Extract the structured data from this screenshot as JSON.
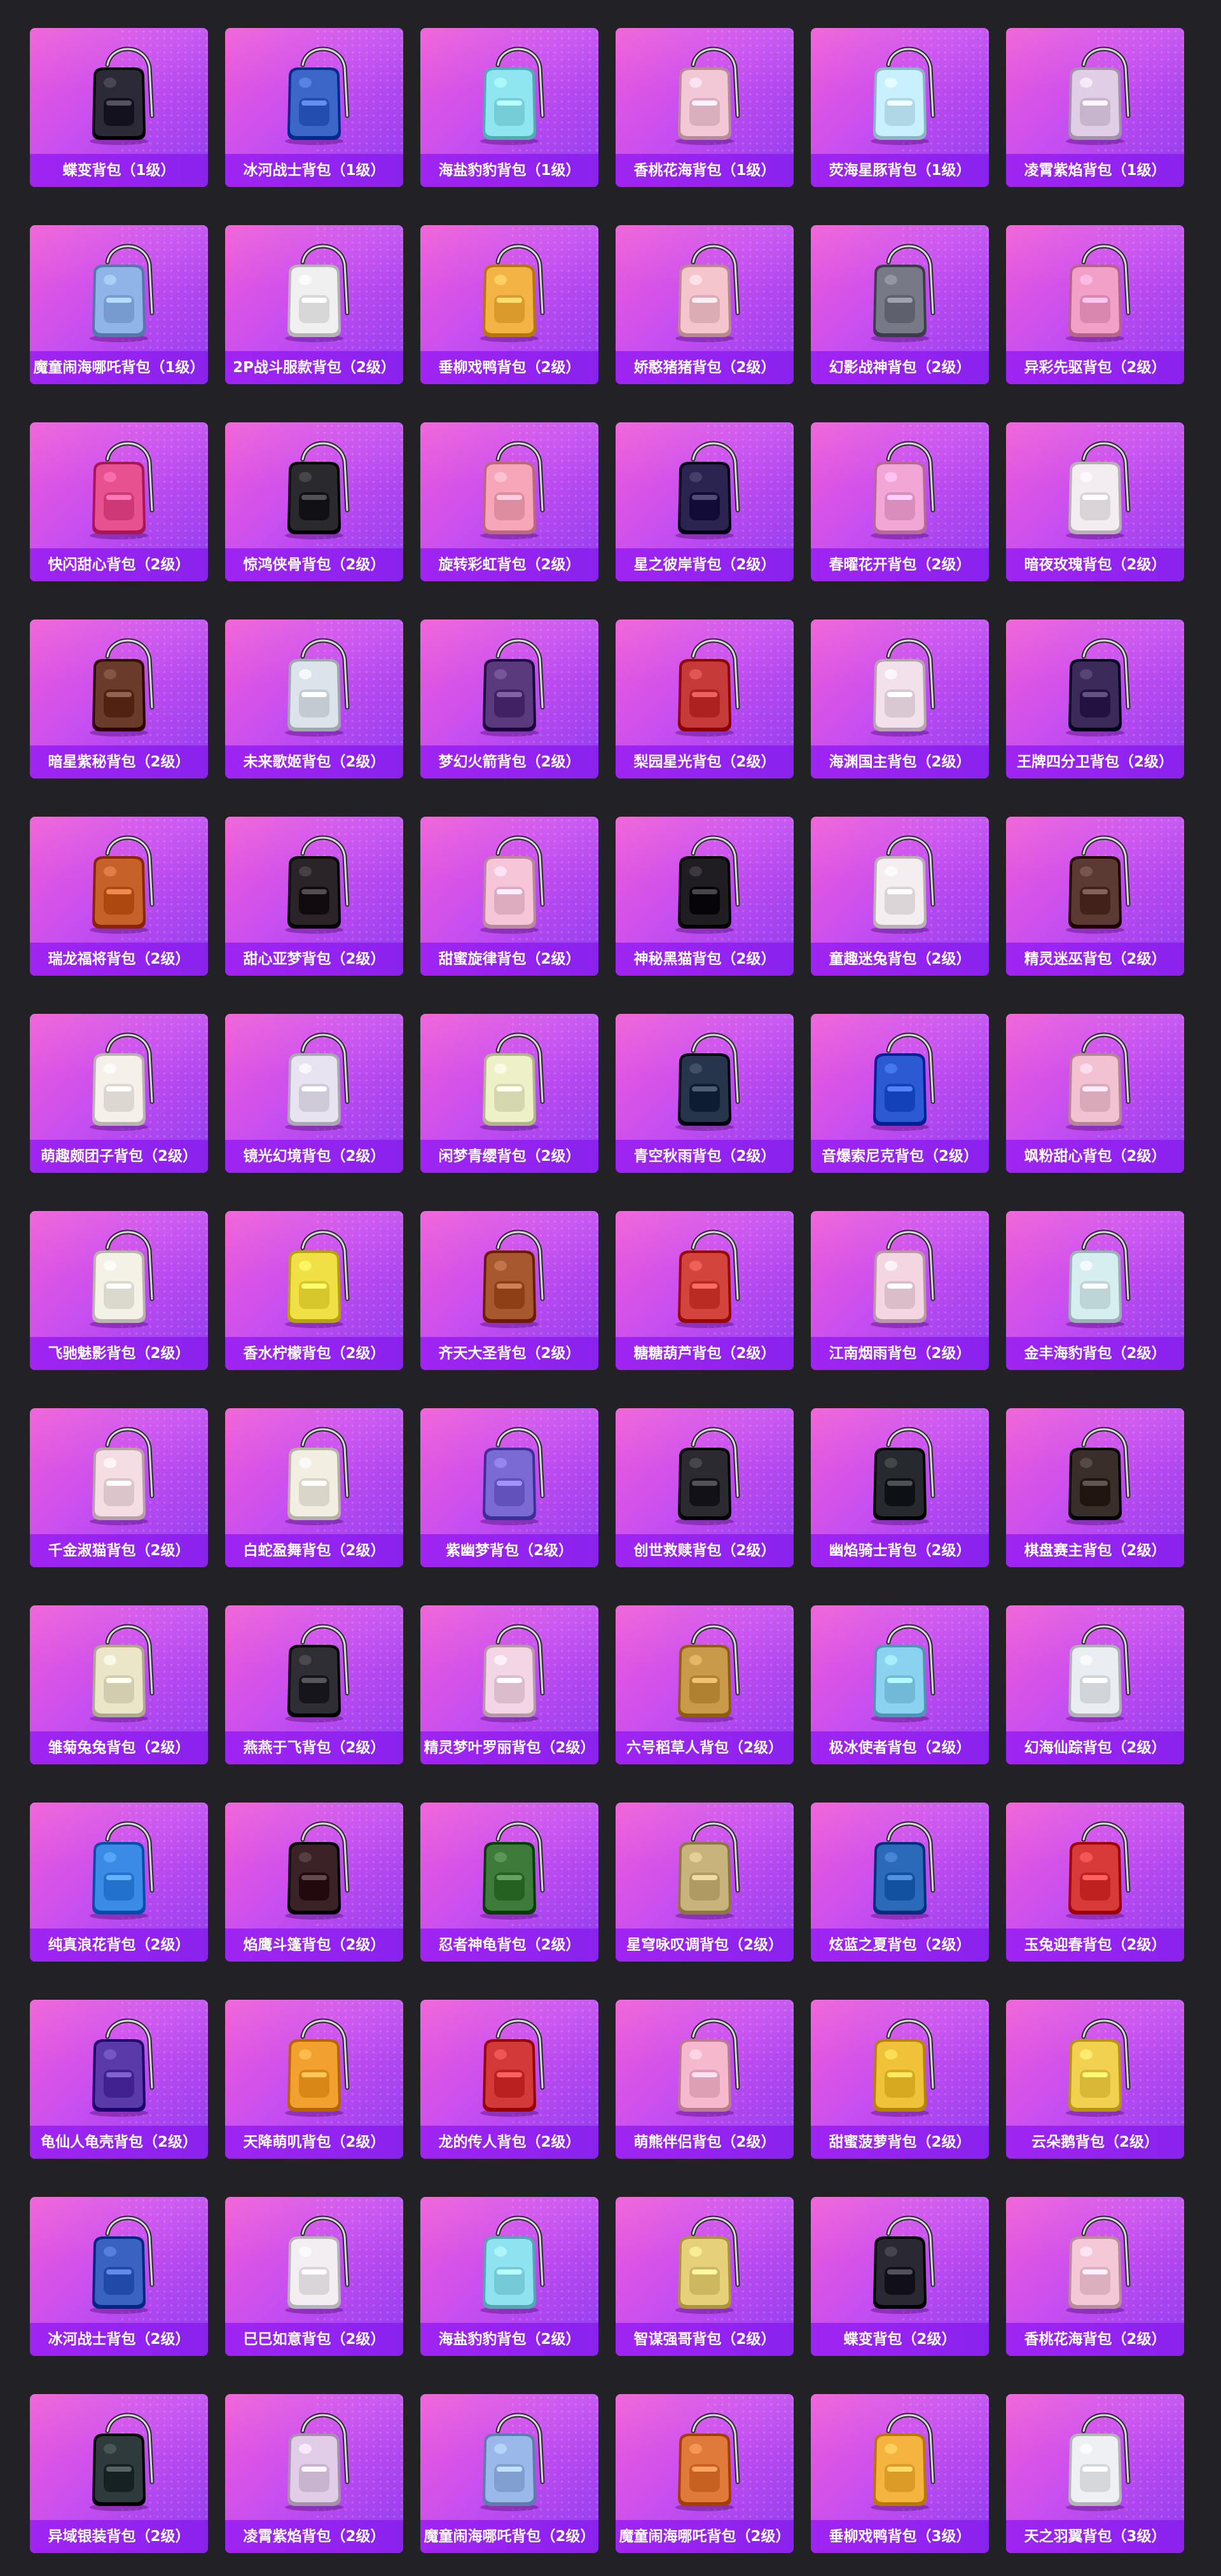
{
  "theme": {
    "page_bg": "#222125",
    "card_bg_start": "#f05bd7",
    "card_bg_end": "#8f3cf0",
    "label_bg": "#9a24f0",
    "label_text": "#ffffff"
  },
  "items": [
    {
      "name": "蝶变背包（1级）",
      "icon": "backpack-icon",
      "color": "#2c2a36"
    },
    {
      "name": "冰河战士背包（1级）",
      "icon": "backpack-icon",
      "color": "#3c66c8"
    },
    {
      "name": "海盐豹豹背包（1级）",
      "icon": "backpack-icon",
      "color": "#8fe6f0"
    },
    {
      "name": "香桃花海背包（1级）",
      "icon": "backpack-icon",
      "color": "#f3c8d6"
    },
    {
      "name": "荧海星豚背包（1级）",
      "icon": "backpack-icon",
      "color": "#c8f0ff"
    },
    {
      "name": "凌霄紫焰背包（1级）",
      "icon": "backpack-icon",
      "color": "#e0cde6"
    },
    {
      "name": "魔童闹海哪吒背包（1级）",
      "icon": "backpack-icon",
      "color": "#8fb4e8"
    },
    {
      "name": "2P战斗服款背包（2级）",
      "icon": "backpack-icon",
      "color": "#f0f0f0"
    },
    {
      "name": "垂柳戏鸭背包（2级）",
      "icon": "backpack-icon",
      "color": "#f3b446"
    },
    {
      "name": "娇憨猪猪背包（2级）",
      "icon": "backpack-icon",
      "color": "#f4c6cc"
    },
    {
      "name": "幻影战神背包（2级）",
      "icon": "backpack-icon",
      "color": "#777a86"
    },
    {
      "name": "异彩先驱背包（2级）",
      "icon": "backpack-icon",
      "color": "#f2a0c8"
    },
    {
      "name": "快闪甜心背包（2级）",
      "icon": "backpack-icon",
      "color": "#e8518f"
    },
    {
      "name": "惊鸿侠骨背包（2级）",
      "icon": "backpack-icon",
      "color": "#2a2a2e"
    },
    {
      "name": "旋转彩虹背包（2级）",
      "icon": "backpack-icon",
      "color": "#f7a5b8"
    },
    {
      "name": "星之彼岸背包（2级）",
      "icon": "backpack-icon",
      "color": "#2b2350"
    },
    {
      "name": "春曜花开背包（2级）",
      "icon": "backpack-icon",
      "color": "#f2a6d6"
    },
    {
      "name": "暗夜玫瑰背包（2级）",
      "icon": "backpack-icon",
      "color": "#f3ecf0"
    },
    {
      "name": "暗星紫秘背包（2级）",
      "icon": "backpack-icon",
      "color": "#6a3a2a"
    },
    {
      "name": "未来歌姬背包（2级）",
      "icon": "backpack-icon",
      "color": "#dde3ea"
    },
    {
      "name": "梦幻火箭背包（2级）",
      "icon": "backpack-icon",
      "color": "#5a3a7c"
    },
    {
      "name": "梨园星光背包（2级）",
      "icon": "backpack-icon",
      "color": "#c73a3a"
    },
    {
      "name": "海渊国主背包（2级）",
      "icon": "backpack-icon",
      "color": "#f2e0ea"
    },
    {
      "name": "王牌四分卫背包（2级）",
      "icon": "backpack-icon",
      "color": "#3b2a5a"
    },
    {
      "name": "瑞龙福将背包（2级）",
      "icon": "backpack-icon",
      "color": "#c7612a"
    },
    {
      "name": "甜心亚梦背包（2级）",
      "icon": "backpack-icon",
      "color": "#2a2328"
    },
    {
      "name": "甜蜜旋律背包（2级）",
      "icon": "backpack-icon",
      "color": "#f5c6d8"
    },
    {
      "name": "神秘黑猫背包（2级）",
      "icon": "backpack-icon",
      "color": "#1f1c22"
    },
    {
      "name": "童趣迷兔背包（2级）",
      "icon": "backpack-icon",
      "color": "#f5eef0"
    },
    {
      "name": "精灵迷巫背包（2级）",
      "icon": "backpack-icon",
      "color": "#5a3a32"
    },
    {
      "name": "萌趣颇团子背包（2级）",
      "icon": "backpack-icon",
      "color": "#f5f0ea"
    },
    {
      "name": "镜光幻境背包（2级）",
      "icon": "backpack-icon",
      "color": "#e7e3f0"
    },
    {
      "name": "闲梦青缨背包（2级）",
      "icon": "backpack-icon",
      "color": "#eef0c8"
    },
    {
      "name": "青空秋雨背包（2级）",
      "icon": "backpack-icon",
      "color": "#26344c"
    },
    {
      "name": "音爆索尼克背包（2级）",
      "icon": "backpack-icon",
      "color": "#2b5ad2"
    },
    {
      "name": "飒粉甜心背包（2级）",
      "icon": "backpack-icon",
      "color": "#f3c2d2"
    },
    {
      "name": "飞驰魅影背包（2级）",
      "icon": "backpack-icon",
      "color": "#f4f2e6"
    },
    {
      "name": "香水柠檬背包（2级）",
      "icon": "backpack-icon",
      "color": "#f0e046"
    },
    {
      "name": "齐天大圣背包（2级）",
      "icon": "backpack-icon",
      "color": "#a8582e"
    },
    {
      "name": "糖糖葫芦背包（2级）",
      "icon": "backpack-icon",
      "color": "#d2443c"
    },
    {
      "name": "江南烟雨背包（2级）",
      "icon": "backpack-icon",
      "color": "#f2d6e2"
    },
    {
      "name": "金丰海豹背包（2级）",
      "icon": "backpack-icon",
      "color": "#d6eef0"
    },
    {
      "name": "千金淑猫背包（2级）",
      "icon": "backpack-icon",
      "color": "#f4dee4"
    },
    {
      "name": "白蛇盈舞背包（2级）",
      "icon": "backpack-icon",
      "color": "#f2efe2"
    },
    {
      "name": "紫幽梦背包（2级）",
      "icon": "backpack-icon",
      "color": "#7a6ad2"
    },
    {
      "name": "创世救赎背包（2级）",
      "icon": "backpack-icon",
      "color": "#2a2a30"
    },
    {
      "name": "幽焰骑士背包（2级）",
      "icon": "backpack-icon",
      "color": "#262a2e"
    },
    {
      "name": "棋盘赛主背包（2级）",
      "icon": "backpack-icon",
      "color": "#3a2e2a"
    },
    {
      "name": "雏菊兔兔背包（2级）",
      "icon": "backpack-icon",
      "color": "#ece6c8"
    },
    {
      "name": "燕燕于飞背包（2级）",
      "icon": "backpack-icon",
      "color": "#2e2e34"
    },
    {
      "name": "精灵梦叶罗丽背包（2级）",
      "icon": "backpack-icon",
      "color": "#f2d6e6"
    },
    {
      "name": "六号稻草人背包（2级）",
      "icon": "backpack-icon",
      "color": "#c89a4a"
    },
    {
      "name": "极冰使者背包（2级）",
      "icon": "backpack-icon",
      "color": "#8ad2f0"
    },
    {
      "name": "幻海仙踪背包（2级）",
      "icon": "backpack-icon",
      "color": "#eaeef2"
    },
    {
      "name": "纯真浪花背包（2级）",
      "icon": "backpack-icon",
      "color": "#3a8ae6"
    },
    {
      "name": "焰鹰斗篷背包（2级）",
      "icon": "backpack-icon",
      "color": "#3a2226"
    },
    {
      "name": "忍者神龟背包（2级）",
      "icon": "backpack-icon",
      "color": "#3e7a3a"
    },
    {
      "name": "星穹咏叹调背包（2级）",
      "icon": "backpack-icon",
      "color": "#c8b47a"
    },
    {
      "name": "炫蓝之夏背包（2级）",
      "icon": "backpack-icon",
      "color": "#2a6ab8"
    },
    {
      "name": "玉兔迎春背包（2级）",
      "icon": "backpack-icon",
      "color": "#d83a3a"
    },
    {
      "name": "龟仙人龟壳背包（2级）",
      "icon": "backpack-icon",
      "color": "#5a3aa8"
    },
    {
      "name": "天降萌叽背包（2级）",
      "icon": "backpack-icon",
      "color": "#f2a030"
    },
    {
      "name": "龙的传人背包（2级）",
      "icon": "backpack-icon",
      "color": "#d23a3a"
    },
    {
      "name": "萌熊伴侣背包（2级）",
      "icon": "backpack-icon",
      "color": "#f5b8cc"
    },
    {
      "name": "甜蜜菠萝背包（2级）",
      "icon": "backpack-icon",
      "color": "#f0c23a"
    },
    {
      "name": "云朵鹅背包（2级）",
      "icon": "backpack-icon",
      "color": "#f2d050"
    },
    {
      "name": "冰河战士背包（2级）",
      "icon": "backpack-icon",
      "color": "#3a62c0"
    },
    {
      "name": "巳巳如意背包（2级）",
      "icon": "backpack-icon",
      "color": "#f2eef2"
    },
    {
      "name": "海盐豹豹背包（2级）",
      "icon": "backpack-icon",
      "color": "#8fe2f0"
    },
    {
      "name": "智谋强哥背包（2级）",
      "icon": "backpack-icon",
      "color": "#e6d07a"
    },
    {
      "name": "蝶变背包（2级）",
      "icon": "backpack-icon",
      "color": "#2a2832"
    },
    {
      "name": "香桃花海背包（2级）",
      "icon": "backpack-icon",
      "color": "#f4c8d6"
    },
    {
      "name": "异域银装背包（2级）",
      "icon": "backpack-icon",
      "color": "#2e3a3c"
    },
    {
      "name": "凌霄紫焰背包（2级）",
      "icon": "backpack-icon",
      "color": "#e2cde8"
    },
    {
      "name": "魔童闹海哪吒背包（2级）",
      "icon": "backpack-icon",
      "color": "#9ab8ea"
    },
    {
      "name": "魔童闹海哪吒背包（2级）",
      "icon": "backpack-icon",
      "color": "#e07a3a"
    },
    {
      "name": "垂柳戏鸭背包（3级）",
      "icon": "backpack-icon",
      "color": "#f5b440"
    },
    {
      "name": "天之羽翼背包（3级）",
      "icon": "backpack-icon",
      "color": "#eef0f4"
    }
  ]
}
